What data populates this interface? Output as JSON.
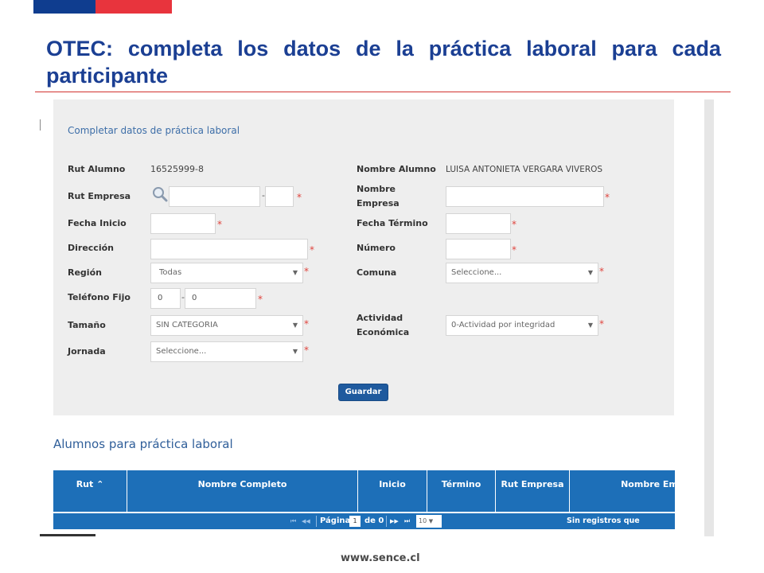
{
  "slide": {
    "title": "OTEC: completa los datos de la práctica laboral para cada participante",
    "footer_url": "www.sence.cl",
    "colors": {
      "flag_blue": "#0f3d8f",
      "flag_red": "#e8343d",
      "title": "#1b3f93",
      "rule": "#d2332f"
    }
  },
  "form": {
    "title": "Completar datos de práctica laboral",
    "rut_alumno": {
      "label": "Rut Alumno",
      "value": "16525999-8"
    },
    "nombre_alumno": {
      "label": "Nombre Alumno",
      "value": "LUISA ANTONIETA VERGARA VIVEROS"
    },
    "rut_empresa": {
      "label": "Rut Empresa",
      "value": "",
      "dv": "",
      "separator": "-",
      "icon": "search-icon"
    },
    "nombre_empresa": {
      "label_line1": "Nombre",
      "label_line2": "Empresa",
      "value": ""
    },
    "fecha_inicio": {
      "label": "Fecha Inicio",
      "value": ""
    },
    "fecha_termino": {
      "label": "Fecha Término",
      "value": ""
    },
    "direccion": {
      "label": "Dirección",
      "value": ""
    },
    "numero": {
      "label": "Número",
      "value": ""
    },
    "region": {
      "label": "Región",
      "selected": "Todas"
    },
    "comuna": {
      "label": "Comuna",
      "selected": "Seleccione..."
    },
    "telefono": {
      "label": "Teléfono Fijo",
      "code": "0",
      "separator": "-",
      "number": "0"
    },
    "tamano": {
      "label": "Tamaño",
      "selected": "SIN CATEGORIA"
    },
    "actividad": {
      "label_line1": "Actividad",
      "label_line2": "Económica",
      "selected": "0-Actividad por integridad"
    },
    "jornada": {
      "label": "Jornada",
      "selected": "Seleccione..."
    },
    "required_mark": "*",
    "save_label": "Guardar",
    "caret": "▼"
  },
  "students": {
    "title": "Alumnos para práctica laboral",
    "columns": [
      "Rut ⌃",
      "Nombre Completo",
      "Inicio",
      "Término",
      "Rut Empresa",
      "Nombre Em"
    ],
    "pager": {
      "first": "⏮",
      "prev": "◀◀",
      "page_label": "Página",
      "page_value": "1",
      "of_label": "de 0",
      "next": "▶▶",
      "last": "⏭",
      "page_size": "10",
      "empty_text": "Sin registros que mostrar"
    }
  }
}
